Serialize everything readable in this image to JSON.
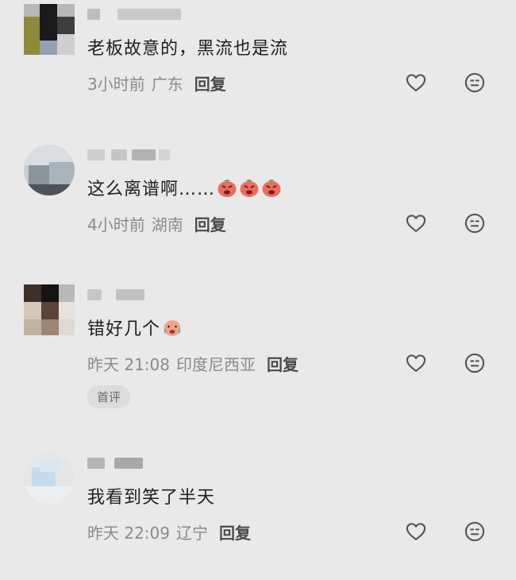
{
  "comments": [
    {
      "text": "老板故意的，黑流也是流",
      "time": "3小时前",
      "location": "广东",
      "reply_label": "回复",
      "emojis": []
    },
    {
      "text": "这么离谱啊……",
      "time": "4小时前",
      "location": "湖南",
      "reply_label": "回复",
      "emojis": [
        "angry-face-emoji",
        "angry-face-emoji",
        "angry-face-emoji"
      ]
    },
    {
      "text": "错好几个",
      "time": "昨天 21:08",
      "location": "印度尼西亚",
      "reply_label": "回复",
      "badge": "首评",
      "emojis": [
        "crying-face-emoji"
      ]
    },
    {
      "text": "我看到笑了半天",
      "time": "昨天 22:09",
      "location": "辽宁",
      "reply_label": "回复",
      "emojis": []
    }
  ],
  "icons": {
    "like": "heart-outline-icon",
    "reaction": "neutral-face-icon"
  },
  "colors": {
    "background": "#e9e9ea",
    "text": "#1e1e1e",
    "meta": "#8a8a8a",
    "reply": "#4a4a4a",
    "icon": "#555555"
  }
}
